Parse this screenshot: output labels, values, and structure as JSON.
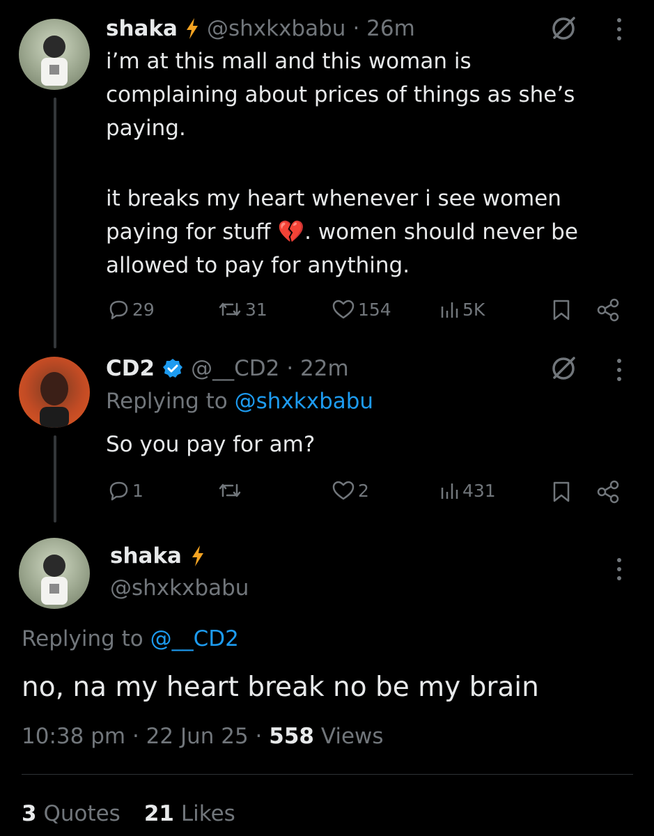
{
  "tweet1": {
    "name": "shaka",
    "handle": "@shxkxbabu",
    "time": "· 26m",
    "text_p1": "i’m at this mall and this woman is\ncomplaining about prices of things as she’s\npaying.",
    "text_p2a": "it breaks my heart whenever i see women\npaying for stuff ",
    "text_p2b": ". women should never be",
    "text_p2c": "allowed to pay for anything.",
    "emoji": "💔",
    "replies": "29",
    "reposts": "31",
    "likes": "154",
    "views": "5K"
  },
  "tweet2": {
    "name": "CD2",
    "handle": "@__CD2",
    "time": "· 22m",
    "replying_prefix": "Replying to",
    "replying_handle": "@shxkxbabu",
    "text": "So you pay for am?",
    "replies": "1",
    "likes": "2",
    "views": "431"
  },
  "main": {
    "name": "shaka",
    "handle": "@shxkxbabu",
    "replying_prefix": "Replying to",
    "replying_handle": "@__CD2",
    "text": "no, na my heart break no be my brain",
    "time": "10:38 pm",
    "date": "· 22 Jun 25 ·",
    "views_count": "558",
    "views_label": "Views",
    "quotes_count": "3",
    "quotes_label": "Quotes",
    "likes_count": "21",
    "likes_label": "Likes"
  },
  "colors": {
    "background": "#000000",
    "text": "#e7e9ea",
    "muted": "#71767b",
    "link": "#1d9bf0",
    "verified": "#1d9bf0",
    "bolt": "#f4a322"
  }
}
